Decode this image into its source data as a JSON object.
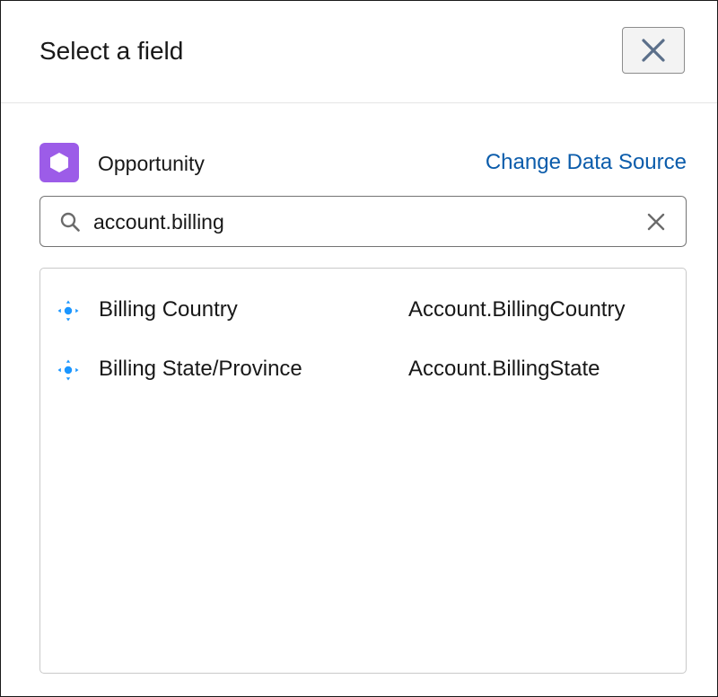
{
  "modal": {
    "title": "Select a field",
    "close_icon": "close-icon"
  },
  "data_source": {
    "object_icon": "object-hexagon-icon",
    "object_icon_color": "#9c5ce8",
    "object_label": "Opportunity",
    "change_link_label": "Change Data Source",
    "link_color": "#0b5cab"
  },
  "search": {
    "icon": "search-icon",
    "value": "account.billing",
    "placeholder": "",
    "clear_icon": "clear-icon"
  },
  "results": {
    "field_icon": "field-icon",
    "field_icon_color": "#1b96ff",
    "items": [
      {
        "label": "Billing Country",
        "api_name": "Account.BillingCountry"
      },
      {
        "label": "Billing State/Province",
        "api_name": "Account.BillingState"
      }
    ]
  }
}
